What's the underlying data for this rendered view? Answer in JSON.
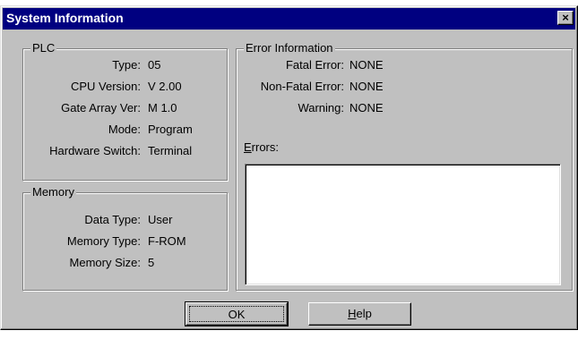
{
  "window": {
    "title": "System Information",
    "close_glyph": "×"
  },
  "plc": {
    "group_label": "PLC",
    "fields": [
      {
        "label": "Type:",
        "value": "05"
      },
      {
        "label": "CPU Version:",
        "value": "V 2.00"
      },
      {
        "label": "Gate Array Ver:",
        "value": "M 1.0"
      },
      {
        "label": "Mode:",
        "value": "Program"
      },
      {
        "label": "Hardware Switch:",
        "value": "Terminal"
      }
    ]
  },
  "memory": {
    "group_label": "Memory",
    "fields": [
      {
        "label": "Data Type:",
        "value": "User"
      },
      {
        "label": "Memory Type:",
        "value": "F-ROM"
      },
      {
        "label": "Memory Size:",
        "value": "5"
      }
    ]
  },
  "error_info": {
    "group_label": "Error Information",
    "fields": [
      {
        "label": "Fatal Error:",
        "value": "NONE"
      },
      {
        "label": "Non-Fatal Error:",
        "value": "NONE"
      },
      {
        "label": "Warning:",
        "value": "NONE"
      }
    ],
    "errors_label_first": "E",
    "errors_label_rest": "rrors:"
  },
  "buttons": {
    "ok_label": "OK",
    "help_first": "H",
    "help_rest": "elp"
  }
}
